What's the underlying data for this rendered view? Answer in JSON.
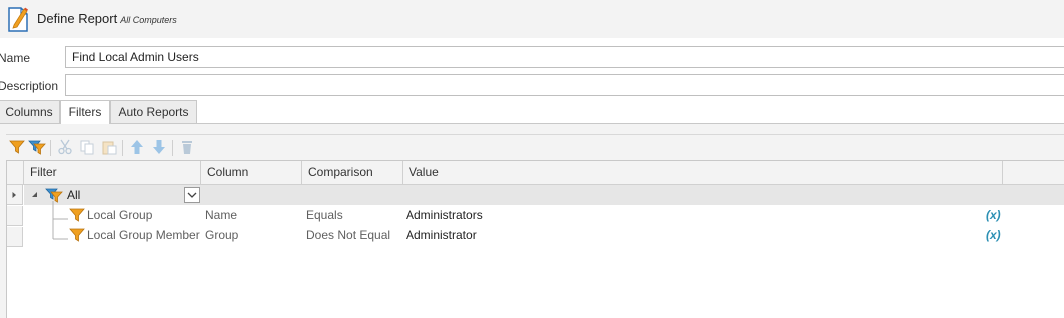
{
  "header": {
    "title": "Define Report",
    "subtitle": "All Computers",
    "icon": "report-edit-icon"
  },
  "form": {
    "name_label": "Name",
    "name_value": "Find Local Admin Users",
    "description_label": "Description",
    "description_value": ""
  },
  "tabs": [
    {
      "label": "Columns",
      "active": false
    },
    {
      "label": "Filters",
      "active": true
    },
    {
      "label": "Auto Reports",
      "active": false
    }
  ],
  "toolbar": {
    "buttons": [
      "add-filter-icon",
      "add-filter-group-icon",
      "cut-icon",
      "copy-icon",
      "paste-icon",
      "move-up-icon",
      "move-down-icon",
      "delete-icon"
    ]
  },
  "grid": {
    "columns": [
      "Filter",
      "Column",
      "Comparison",
      "Value"
    ],
    "group_row": {
      "label": "All",
      "dropdown_icon": "chevron-down-icon"
    },
    "rows": [
      {
        "filter": "Local Group",
        "column": "Name",
        "comparison": "Equals",
        "value": "Administrators",
        "variable": "(x)"
      },
      {
        "filter": "Local Group Member",
        "column": "Group",
        "comparison": "Does Not Equal",
        "value": "Administrator",
        "variable": "(x)"
      }
    ]
  },
  "colors": {
    "accent": "#f0a020",
    "variable": "#2b8fb3",
    "panel": "#f3f3f3"
  }
}
